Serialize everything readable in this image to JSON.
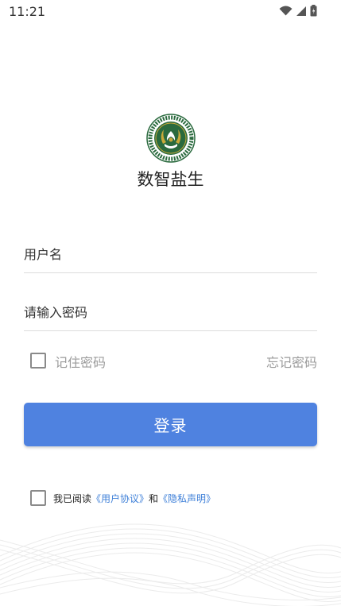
{
  "status_bar": {
    "time": "11:21",
    "icons": [
      "wifi-icon",
      "signal-icon",
      "battery-icon"
    ]
  },
  "app": {
    "name": "数智盐生"
  },
  "login_form": {
    "username_placeholder": "用户名",
    "password_placeholder": "请输入密码",
    "remember_label": "记住密码",
    "forgot_label": "忘记密码",
    "login_label": "登录"
  },
  "agreement": {
    "prefix": "我已阅读",
    "user_agreement": "《用户协议》",
    "conjunction": "和",
    "privacy_statement": "《隐私声明》"
  },
  "colors": {
    "primary": "#4f82e0",
    "link": "#3d7fd8",
    "logo_green": "#2a6a3e",
    "logo_gold": "#c9a93a"
  }
}
